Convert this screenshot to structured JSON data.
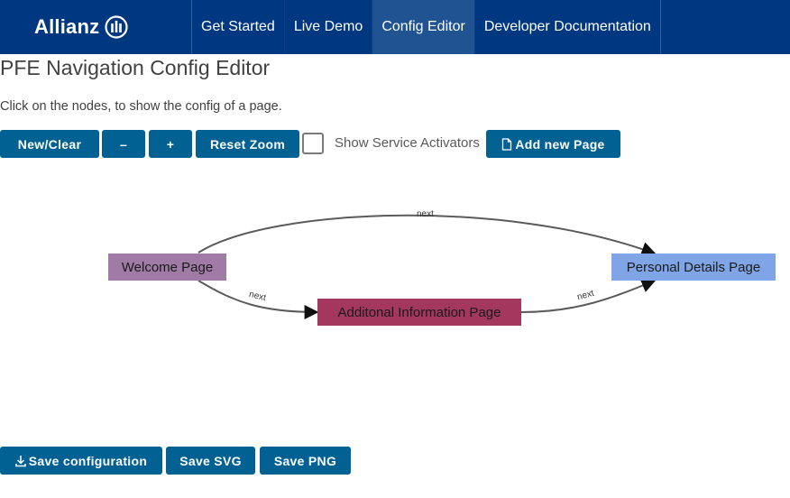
{
  "brand": {
    "name": "Allianz",
    "logo_icon": "allianz-eagle-icon"
  },
  "nav": {
    "items": [
      {
        "label": "Get Started"
      },
      {
        "label": "Live Demo"
      },
      {
        "label": "Config Editor",
        "active": true
      },
      {
        "label": "Developer Documentation"
      }
    ]
  },
  "page": {
    "title": "PFE Navigation Config Editor",
    "instructions": "Click on the nodes, to show the config of a page."
  },
  "toolbar": {
    "new_clear": "New/Clear",
    "zoom_out": "–",
    "zoom_in": "+",
    "reset_zoom": "Reset Zoom",
    "show_service_activators": "Show Service Activators",
    "show_service_activators_checked": false,
    "add_page": "Add new Page",
    "add_page_icon": "file-icon"
  },
  "graph": {
    "nodes": [
      {
        "id": "welcome",
        "label": "Welcome Page",
        "color": "#a07ba6"
      },
      {
        "id": "additional",
        "label": "Additonal Information Page",
        "color": "#a3375e"
      },
      {
        "id": "personal",
        "label": "Personal Details Page",
        "color": "#7fa5e6"
      }
    ],
    "edges": [
      {
        "from": "welcome",
        "to": "personal",
        "label": "next"
      },
      {
        "from": "welcome",
        "to": "additional",
        "label": "next"
      },
      {
        "from": "additional",
        "to": "personal",
        "label": "next"
      }
    ]
  },
  "footer": {
    "save_configuration": "Save configuration",
    "save_configuration_icon": "download-icon",
    "save_svg": "Save SVG",
    "save_png": "Save PNG"
  },
  "colors": {
    "nav_bg": "#003781",
    "button_bg": "#006192",
    "edge": "#5b5b5b"
  }
}
